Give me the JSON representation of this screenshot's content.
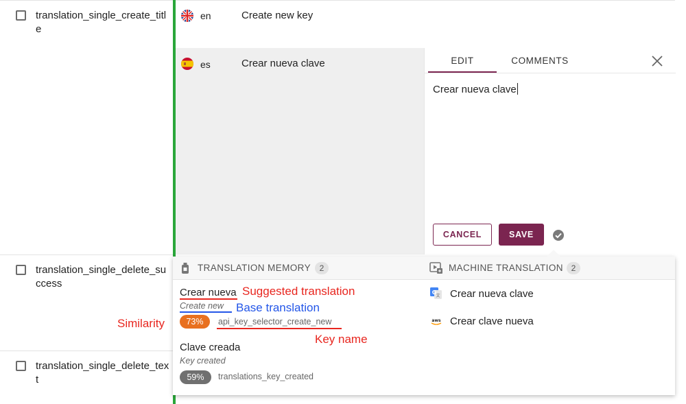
{
  "rows": [
    {
      "key": "translation_single_create_title"
    },
    {
      "key": "translation_single_delete_success"
    },
    {
      "key": "translation_single_delete_text"
    }
  ],
  "languages": {
    "en": {
      "code": "en",
      "text": "Create new key"
    },
    "es": {
      "code": "es",
      "text": "Crear nueva clave"
    }
  },
  "editor": {
    "tabs": [
      "EDIT",
      "COMMENTS"
    ],
    "value": "Crear nueva clave",
    "cancel_label": "CANCEL",
    "save_label": "SAVE"
  },
  "translation_memory": {
    "title": "TRANSLATION MEMORY",
    "count": "2",
    "items": [
      {
        "text": "Crear nueva",
        "base": "Create new",
        "similarity": "73%",
        "key": "api_key_selector_create_new"
      },
      {
        "text": "Clave creada",
        "base": "Key created",
        "similarity": "59%",
        "key": "translations_key_created"
      }
    ]
  },
  "machine_translation": {
    "title": "MACHINE TRANSLATION",
    "count": "2",
    "items": [
      {
        "provider": "google-translate-icon",
        "text": "Crear nueva clave"
      },
      {
        "provider": "aws-icon",
        "text": "Crear clave nueva"
      }
    ]
  },
  "annotations": {
    "suggested": "Suggested translation",
    "base": "Base translation",
    "similarity": "Similarity",
    "key_name": "Key name"
  },
  "colors": {
    "accent": "#7b2550",
    "green": "#2aa63a",
    "badge_high": "#e8701f",
    "badge_low": "#707070",
    "annotation_red": "#e8261f",
    "annotation_blue": "#2356e8"
  }
}
